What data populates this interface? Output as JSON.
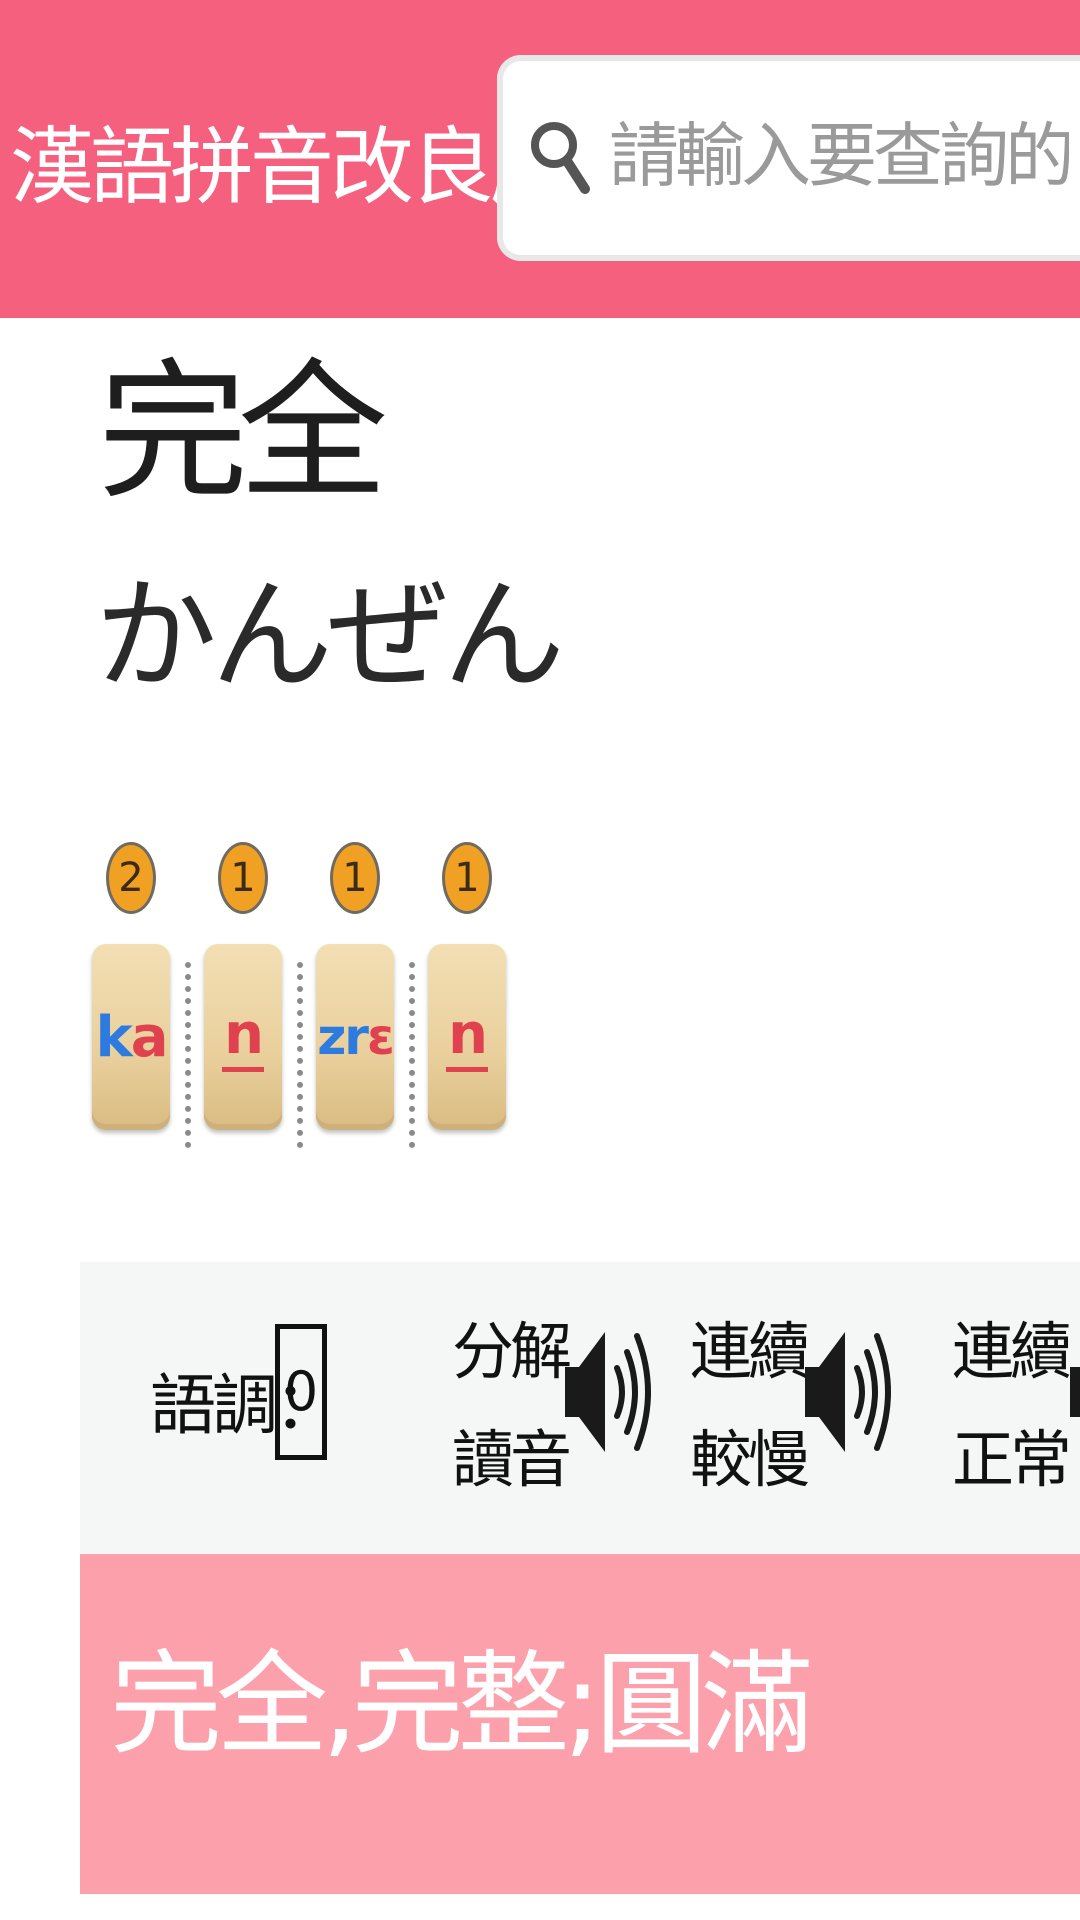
{
  "header": {
    "mode_label": "漢語拼音改良版",
    "search": {
      "placeholder": "請輸入要查詢的單字"
    }
  },
  "entry": {
    "word": "完全",
    "reading": "かんぜん",
    "syllables": [
      {
        "badge": "2",
        "parts": [
          {
            "text": "k",
            "color": "blue"
          },
          {
            "text": "a",
            "color": "red"
          }
        ]
      },
      {
        "badge": "1",
        "parts": [
          {
            "text": "n",
            "color": "red",
            "underline": true
          }
        ]
      },
      {
        "badge": "1",
        "parts": [
          {
            "text": "zr",
            "color": "blue"
          },
          {
            "text": "ɛ",
            "color": "red"
          }
        ]
      },
      {
        "badge": "1",
        "parts": [
          {
            "text": "n",
            "color": "red",
            "underline": true
          }
        ]
      }
    ]
  },
  "controls": {
    "tone_label": "語調：",
    "tone_value": "0",
    "split_line1": "分解",
    "split_line2": "讀音",
    "slow_line1": "連續",
    "slow_line2": "較慢",
    "normal_line1": "連續",
    "normal_line2": "正常"
  },
  "meaning": "完全,完整;圓滿",
  "colors": {
    "header_bg": "#f5607f",
    "meaning_bg": "#fca1ac",
    "badge": "#f0a123",
    "tile": "#ecd3a3",
    "syllable_blue": "#2e7be0",
    "syllable_red": "#e0414f"
  },
  "icons": [
    "chevron-down-icon",
    "search-icon",
    "speaker-icon"
  ]
}
